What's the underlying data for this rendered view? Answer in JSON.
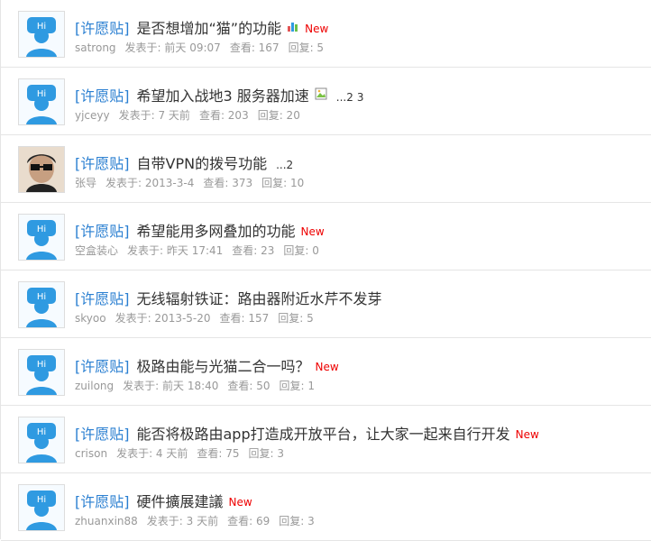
{
  "threads": [
    {
      "tag": "[许愿贴]",
      "subject": "是否想增加“猫”的功能",
      "author": "satrong",
      "posted": "发表于: 前天 09:07",
      "views": "查看: 167",
      "replies": "回复: 5",
      "new": "New",
      "icon": "poll-icon"
    },
    {
      "tag": "[许愿贴]",
      "subject": "希望加入战地3 服务器加速",
      "author": "yjceyy",
      "posted": "发表于: 7 天前",
      "views": "查看: 203",
      "replies": "回复: 20",
      "icon": "image-attachment-icon",
      "pages": [
        "...2",
        "3"
      ]
    },
    {
      "tag": "[许愿贴]",
      "subject": "自带VPN的拨号功能",
      "author": "张导",
      "posted": "发表于: 2013-3-4",
      "views": "查看: 373",
      "replies": "回复: 10",
      "pages": [
        "...2"
      ],
      "photo": true
    },
    {
      "tag": "[许愿贴]",
      "subject": "希望能用多网叠加的功能",
      "author": "空盒装心",
      "posted": "发表于: 昨天 17:41",
      "views": "查看: 23",
      "replies": "回复: 0",
      "new": "New"
    },
    {
      "tag": "[许愿贴]",
      "subject": "无线辐射铁证：路由器附近水芹不发芽",
      "author": "skyoo",
      "posted": "发表于: 2013-5-20",
      "views": "查看: 157",
      "replies": "回复: 5"
    },
    {
      "tag": "[许愿贴]",
      "subject": "极路由能与光猫二合一吗？",
      "author": "zuilong",
      "posted": "发表于: 前天 18:40",
      "views": "查看: 50",
      "replies": "回复: 1",
      "new": "New"
    },
    {
      "tag": "[许愿贴]",
      "subject": "能否将极路由app打造成开放平台，让大家一起来自行开发",
      "author": "crison",
      "posted": "发表于: 4 天前",
      "views": "查看: 75",
      "replies": "回复: 3",
      "new": "New"
    },
    {
      "tag": "[许愿贴]",
      "subject": "硬件擴展建議",
      "author": "zhuanxin88",
      "posted": "发表于: 3 天前",
      "views": "查看: 69",
      "replies": "回复: 3",
      "new": "New"
    }
  ]
}
